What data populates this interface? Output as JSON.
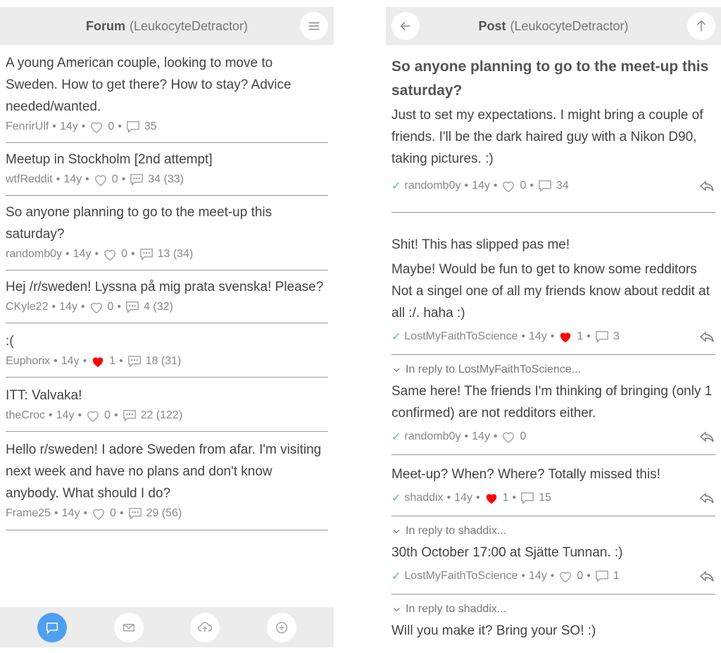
{
  "forum": {
    "title": "Forum",
    "user": "(LeukocyteDetractor)",
    "threads": [
      {
        "title": "A young American couple, looking to move to Sweden. How to get there? How to stay? Advice needed/wanted.",
        "author": "FenrirUlf",
        "age": "14y",
        "likes": "0",
        "liked": false,
        "comments": "35",
        "icon": "comment-icon"
      },
      {
        "title": "Meetup in Stockholm [2nd attempt]",
        "author": "wtfReddit",
        "age": "14y",
        "likes": "0",
        "liked": false,
        "comments": "34 (33)",
        "icon": "comment-dots-icon"
      },
      {
        "title": "So anyone planning to go to the meet-up this saturday?",
        "author": "randomb0y",
        "age": "14y",
        "likes": "0",
        "liked": false,
        "comments": "13 (34)",
        "icon": "comment-dots-icon"
      },
      {
        "title": "Hej /r/sweden! Lyssna på mig prata svenska! Please?",
        "author": "CKyle22",
        "age": "14y",
        "likes": "0",
        "liked": false,
        "comments": "4 (32)",
        "icon": "comment-dots-icon"
      },
      {
        "title": ":(",
        "author": "Euphorix",
        "age": "14y",
        "likes": "1",
        "liked": true,
        "comments": "18 (31)",
        "icon": "comment-dots-icon"
      },
      {
        "title": "ITT: Valvaka!",
        "author": "theCroc",
        "age": "14y",
        "likes": "0",
        "liked": false,
        "comments": "22 (122)",
        "icon": "comment-dots-icon"
      },
      {
        "title": "Hello r/sweden! I adore Sweden from afar. I'm visiting next week and have no plans and don't know anybody. What should I do?",
        "author": "Frame25",
        "age": "14y",
        "likes": "0",
        "liked": false,
        "comments": "29 (56)",
        "icon": "comment-dots-icon"
      }
    ],
    "tabs": [
      "forum-tab",
      "messages-tab",
      "upload-tab",
      "new-post-tab"
    ]
  },
  "post": {
    "title": "Post",
    "user": "(LeukocyteDetractor)",
    "heading": "So anyone planning to go to the meet-up this saturday?",
    "body": "Just to set my expectations. I might bring a couple of friends. I'll be the dark haired guy with a Nikon D90, taking pictures. :)",
    "author": "randomb0y",
    "age": "14y",
    "likes": "0",
    "comments": "34",
    "comments_list": [
      {
        "reply_to": "",
        "lines": [
          "Shit! This has slipped pas me!",
          "Maybe! Would be fun to get to know some redditors Not a singel one of all my friends know about reddit at all :/. haha :)"
        ],
        "author": "LostMyFaithToScience",
        "age": "14y",
        "likes": "1",
        "liked": true,
        "replies": "3"
      },
      {
        "reply_to": "In reply to LostMyFaithToScience...",
        "lines": [
          "Same here! The friends I'm thinking of bringing (only 1 confirmed) are not redditors either."
        ],
        "author": "randomb0y",
        "age": "14y",
        "likes": "0",
        "liked": false,
        "replies": ""
      },
      {
        "reply_to": "",
        "lines": [
          "Meet-up? When? Where? Totally missed this!"
        ],
        "author": "shaddix",
        "age": "14y",
        "likes": "1",
        "liked": true,
        "replies": "15"
      },
      {
        "reply_to": "In reply to shaddix...",
        "lines": [
          "30th October 17:00 at Sjätte Tunnan. :)"
        ],
        "author": "LostMyFaithToScience",
        "age": "14y",
        "likes": "0",
        "liked": false,
        "replies": "1"
      },
      {
        "reply_to": "In reply to shaddix...",
        "lines": [
          "Will you make it? Bring your SO! :)"
        ],
        "author": "",
        "age": "",
        "likes": "",
        "liked": false,
        "replies": ""
      }
    ]
  },
  "colors": {
    "accent": "#4f9ff0",
    "heart": "#ff0000",
    "check": "#4fc29a",
    "bar": "#ececec"
  }
}
